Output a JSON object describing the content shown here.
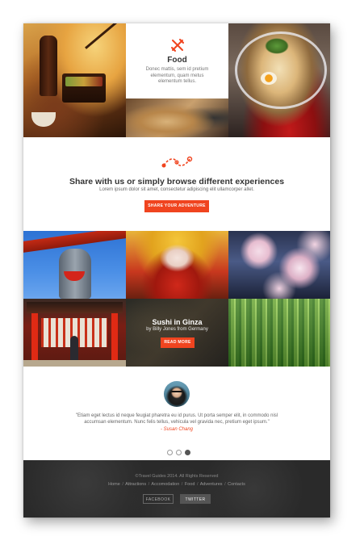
{
  "food_card": {
    "title": "Food",
    "description": "Donec mattis, sem id pretium elementum, quam metus elementum tellus.",
    "icon": "fork-knife-icon"
  },
  "share": {
    "icon": "path-route-icon",
    "title": "Share with us or simply browse different experiences",
    "subtitle": "Lorem ipsum dolor sit amet, consectetur adipiscing elit ullamcorper allet.",
    "button_label": "SHARE YOUR ADVENTURE"
  },
  "featured": {
    "title": "Sushi in Ginza",
    "subtitle": "by Billy Jones from Germany",
    "button_label": "READ MORE"
  },
  "testimonial": {
    "quote": "\"Etiam eget lectus id neque feugiat pharetra eu id purus. Ut porta semper elit, in commodo nisl accumsan elementum. Nunc felis tellus, vehicula vel gravida nec, pretium eget ipsum.\"",
    "author": "- Susan Chang",
    "active_slide": 3,
    "slide_count": 3
  },
  "footer": {
    "copyright": "©Travel Guides 2014. All Rights Reserved",
    "nav": [
      "Home",
      "Attractions",
      "Accomodation",
      "Food",
      "Adventures",
      "Contacts"
    ],
    "nav_separator": "/",
    "facebook_label": "FACEBOOK",
    "twitter_label": "TWITTER"
  },
  "colors": {
    "accent": "#f0441f",
    "footer_bg": "#2a2a2a",
    "heading": "#333333"
  }
}
